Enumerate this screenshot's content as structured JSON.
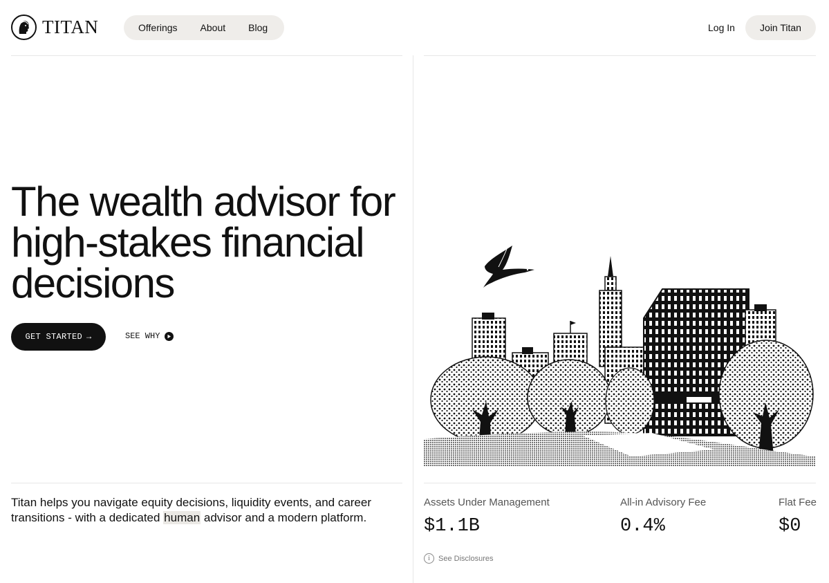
{
  "brand": {
    "name": "TITAN",
    "logo_icon": "coin-head-icon"
  },
  "nav": {
    "items": [
      "Offerings",
      "About",
      "Blog"
    ]
  },
  "header_actions": {
    "login": "Log In",
    "join": "Join Titan"
  },
  "hero": {
    "title": "The wealth advisor for high-stakes financial decisions",
    "cta_primary": "GET STARTED",
    "cta_primary_icon": "arrow-right-icon",
    "cta_secondary": "SEE WHY",
    "cta_secondary_icon": "play-circle-icon"
  },
  "lede": {
    "before": "Titan helps you navigate equity decisions, liquidity events, and career transitions - with a dedicated ",
    "highlight": "human",
    "after": " advisor and a modern platform."
  },
  "stats": [
    {
      "label": "Assets Under Management",
      "value": "$1.1B"
    },
    {
      "label": "All-in Advisory Fee",
      "value": "0.4%"
    },
    {
      "label": "Flat Fee",
      "value": "$0"
    }
  ],
  "disclosures": {
    "label": "See Disclosures",
    "icon": "info-icon"
  },
  "colors": {
    "accent": "#111111",
    "pill_bg": "#efedea",
    "rule": "#e6e6e6"
  }
}
